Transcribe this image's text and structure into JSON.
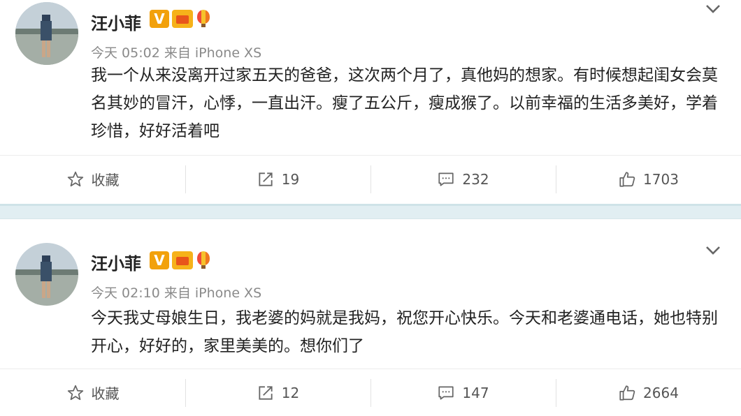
{
  "posts": [
    {
      "author": "汪小菲",
      "time": "今天 05:02",
      "source": "来自 iPhone XS",
      "text": "我一个从来没离开过家五天的爸爸，这次两个月了，真他妈的想家。有时候想起闺女会莫名其妙的冒汗，心悸，一直出汗。瘦了五公斤，瘦成猴了。以前幸福的生活多美好，学着珍惜，好好活着吧",
      "actions": {
        "favorite": "收藏",
        "repost": "19",
        "comment": "232",
        "like": "1703"
      }
    },
    {
      "author": "汪小菲",
      "time": "今天 02:10",
      "source": "来自 iPhone XS",
      "text": "今天我丈母娘生日，我老婆的妈就是我妈，祝您开心快乐。今天和老婆通电话，她也特别开心，好好的，家里美美的。想你们了",
      "actions": {
        "favorite": "收藏",
        "repost": "12",
        "comment": "147",
        "like": "2664"
      }
    }
  ],
  "badges": {
    "v": "V"
  },
  "colors": {
    "accent": "#f2a10c",
    "band": "#e1eef2",
    "meta": "#8a8a8a"
  }
}
